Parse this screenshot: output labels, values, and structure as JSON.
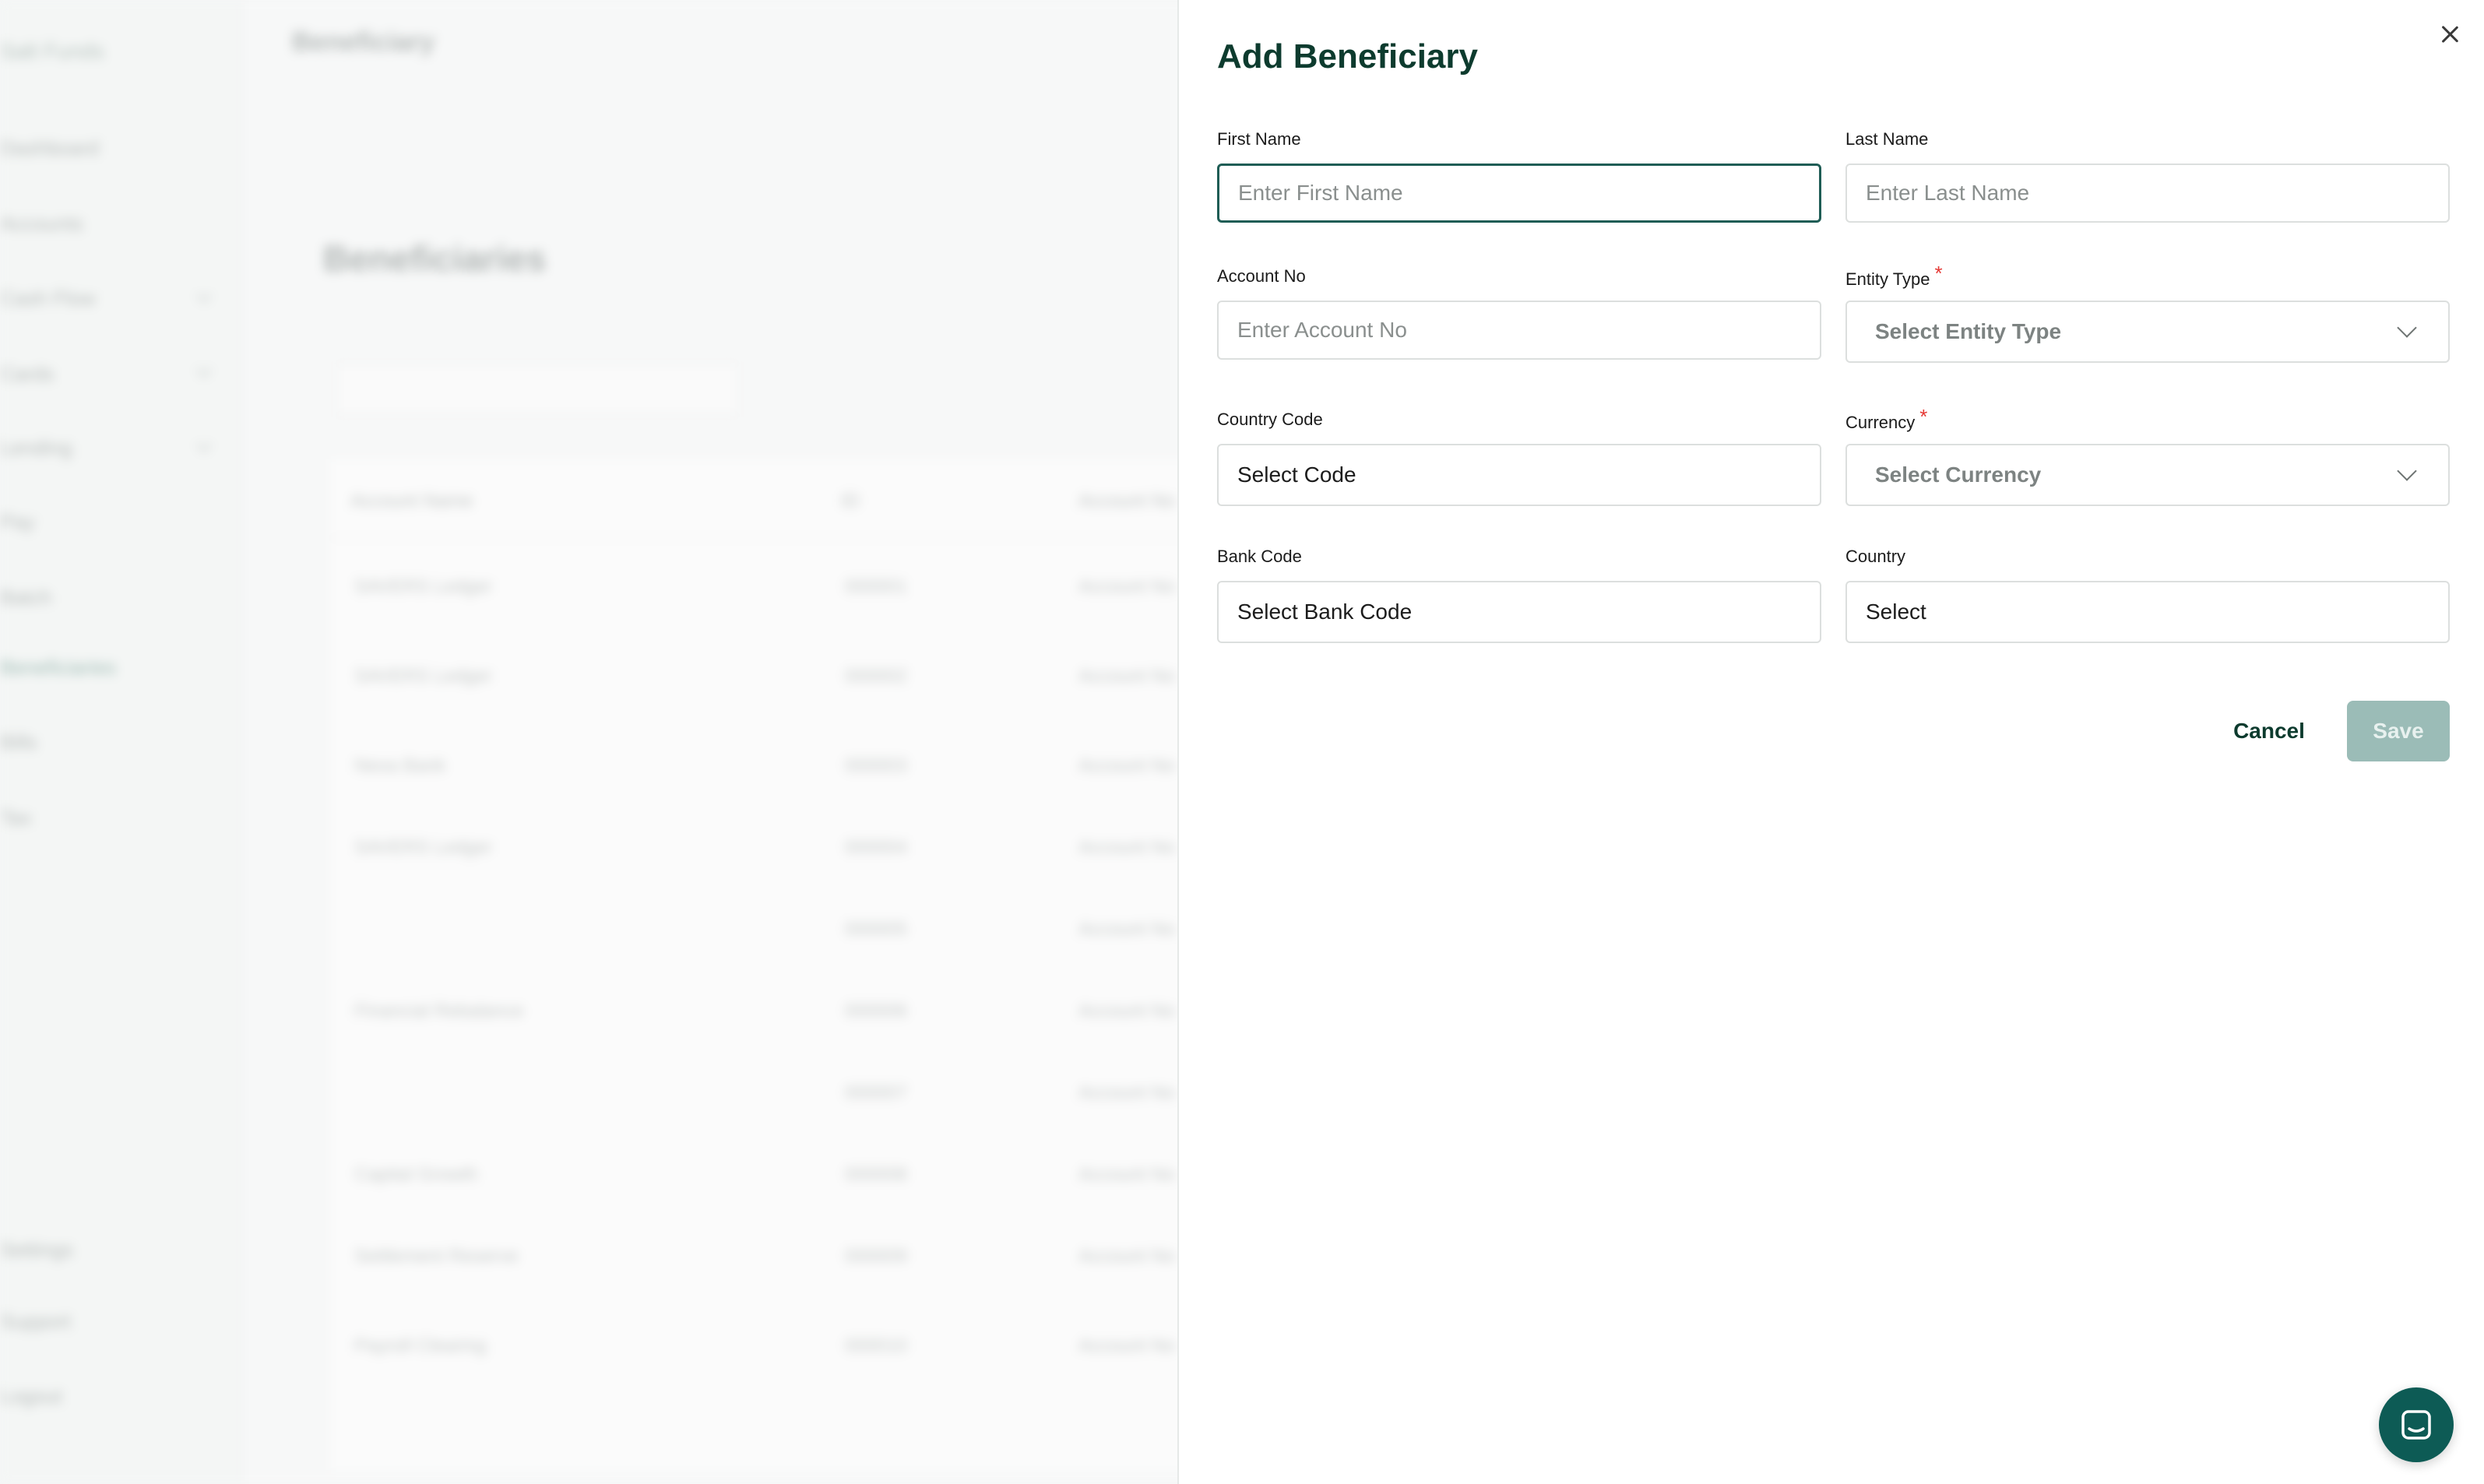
{
  "background": {
    "header_title": "Beneficiary",
    "page_title": "Beneficiaries",
    "org_name": "Salt Funds",
    "sidebar_items": [
      "Dashboard",
      "Accounts",
      "Cash Flow",
      "Cards",
      "Lending",
      "Pay",
      "Batch",
      "Beneficiaries",
      "Bills",
      "Tax",
      "Settings",
      "Support",
      "Logout"
    ],
    "table_headers": [
      "Account Name",
      "ID",
      "Account No"
    ],
    "table_rows": [
      [
        "SAVERS Ledger",
        "000001",
        "Account No"
      ],
      [
        "SAVERS Ledger",
        "000002",
        "Account No"
      ],
      [
        "Nexa Bank",
        "000003",
        "Account No"
      ],
      [
        "SAVERS Ledger",
        "000004",
        "Account No"
      ],
      [
        "",
        "000005",
        "Account No"
      ],
      [
        "Financial Rebalance",
        "000006",
        "Account No"
      ],
      [
        "",
        "000007",
        "Account No"
      ],
      [
        "Capital Growth",
        "000008",
        "Account No"
      ],
      [
        "Settlement Reserve",
        "000009",
        "Account No"
      ],
      [
        "Payroll Clearing",
        "000010",
        "Account No"
      ]
    ]
  },
  "drawer": {
    "title": "Add Beneficiary",
    "first_name": {
      "label": "First Name",
      "placeholder": "Enter First Name",
      "value": ""
    },
    "last_name": {
      "label": "Last Name",
      "placeholder": "Enter Last Name",
      "value": ""
    },
    "account_no": {
      "label": "Account No",
      "placeholder": "Enter Account No",
      "value": ""
    },
    "entity_type": {
      "label": "Entity Type",
      "required_mark": "*",
      "selected": "Select Entity Type"
    },
    "country_code": {
      "label": "Country Code",
      "selected": "Select Code"
    },
    "currency": {
      "label": "Currency",
      "required_mark": "*",
      "selected": "Select Currency"
    },
    "bank_code": {
      "label": "Bank Code",
      "selected": "Select Bank Code"
    },
    "country": {
      "label": "Country",
      "selected": "Select"
    },
    "cancel_label": "Cancel",
    "save_label": "Save"
  },
  "colors": {
    "brand_dark": "#0d3b2e",
    "focus_border": "#1f5d55",
    "save_disabled": "#9bbcb7",
    "required": "#e53935",
    "chat_fab": "#0d5b55"
  },
  "icons": {
    "close": "close-icon",
    "dropdown": "chevron-down-icon",
    "chat": "chat-icon"
  }
}
